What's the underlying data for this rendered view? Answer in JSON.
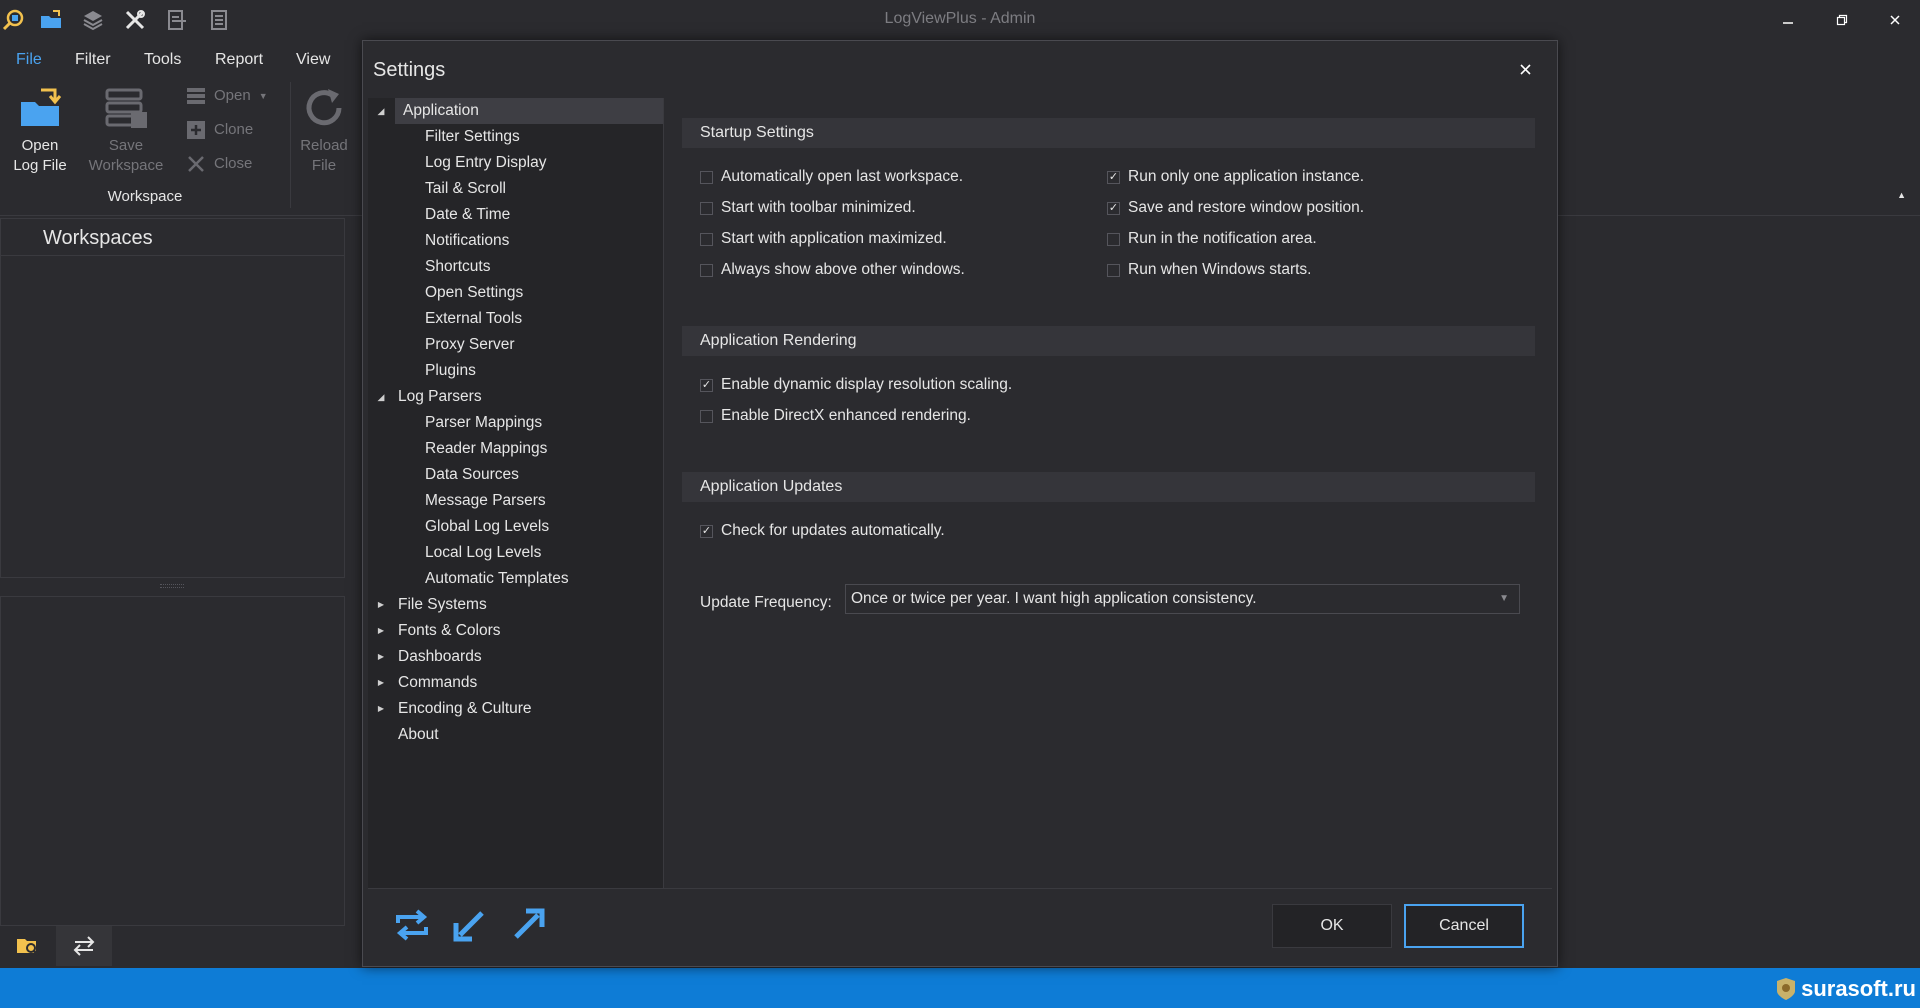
{
  "window": {
    "title": "LogViewPlus - Admin"
  },
  "ribbon": {
    "tabs": [
      "File",
      "Filter",
      "Tools",
      "Report",
      "View"
    ],
    "active_tab": "File",
    "open_log_file": "Open\nLog File",
    "save_workspace": "Save\nWorkspace",
    "reload_file": "Reload\nFile",
    "open": "Open",
    "clone": "Clone",
    "close": "Close",
    "group_label": "Workspace"
  },
  "workspaces": {
    "title": "Workspaces"
  },
  "dialog": {
    "title": "Settings",
    "tree": [
      {
        "label": "Application",
        "level": 0,
        "arrow": "expanded",
        "selected": true
      },
      {
        "label": "Filter Settings",
        "level": 1
      },
      {
        "label": "Log Entry Display",
        "level": 1
      },
      {
        "label": "Tail & Scroll",
        "level": 1
      },
      {
        "label": "Date & Time",
        "level": 1
      },
      {
        "label": "Notifications",
        "level": 1
      },
      {
        "label": "Shortcuts",
        "level": 1
      },
      {
        "label": "Open Settings",
        "level": 1
      },
      {
        "label": "External Tools",
        "level": 1
      },
      {
        "label": "Proxy Server",
        "level": 1
      },
      {
        "label": "Plugins",
        "level": 1
      },
      {
        "label": "Log Parsers",
        "level": 0,
        "arrow": "expanded"
      },
      {
        "label": "Parser Mappings",
        "level": 1
      },
      {
        "label": "Reader Mappings",
        "level": 1
      },
      {
        "label": "Data Sources",
        "level": 1
      },
      {
        "label": "Message Parsers",
        "level": 1
      },
      {
        "label": "Global Log Levels",
        "level": 1
      },
      {
        "label": "Local Log Levels",
        "level": 1
      },
      {
        "label": "Automatic Templates",
        "level": 1
      },
      {
        "label": "File Systems",
        "level": 0,
        "arrow": "collapsed"
      },
      {
        "label": "Fonts & Colors",
        "level": 0,
        "arrow": "collapsed"
      },
      {
        "label": "Dashboards",
        "level": 0,
        "arrow": "collapsed"
      },
      {
        "label": "Commands",
        "level": 0,
        "arrow": "collapsed"
      },
      {
        "label": "Encoding & Culture",
        "level": 0,
        "arrow": "collapsed"
      },
      {
        "label": "About",
        "level": 0
      }
    ],
    "startup": {
      "header": "Startup Settings",
      "left": [
        {
          "label": "Automatically open last workspace.",
          "checked": false
        },
        {
          "label": "Start with toolbar minimized.",
          "checked": false
        },
        {
          "label": "Start with application maximized.",
          "checked": false
        },
        {
          "label": "Always show above other windows.",
          "checked": false
        }
      ],
      "right": [
        {
          "label": "Run only one application instance.",
          "checked": true
        },
        {
          "label": "Save and restore window position.",
          "checked": true
        },
        {
          "label": "Run in the notification area.",
          "checked": false
        },
        {
          "label": "Run when Windows starts.",
          "checked": false
        }
      ]
    },
    "rendering": {
      "header": "Application Rendering",
      "items": [
        {
          "label": "Enable dynamic display resolution scaling.",
          "checked": true
        },
        {
          "label": "Enable DirectX enhanced rendering.",
          "checked": false
        }
      ]
    },
    "updates": {
      "header": "Application Updates",
      "check_label": "Check for updates automatically.",
      "check_checked": true,
      "frequency_label": "Update Frequency:",
      "frequency_value": "Once or twice per year.  I want high application consistency."
    },
    "ok": "OK",
    "cancel": "Cancel"
  },
  "brand": "surasoft.ru",
  "colors": {
    "accent": "#4aa3f0",
    "statusbar": "#0e7cd6",
    "background": "#2b2b2f"
  }
}
